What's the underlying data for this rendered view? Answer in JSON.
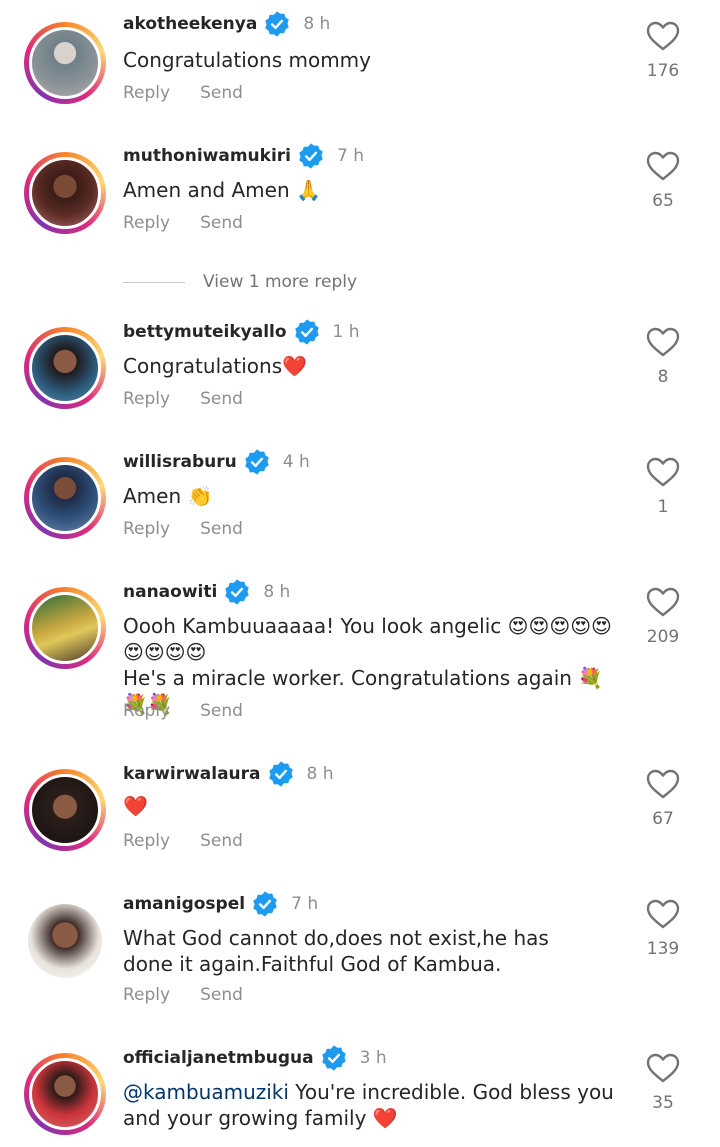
{
  "labels": {
    "reply": "Reply",
    "send": "Send",
    "view_more": "View 1 more reply"
  },
  "comments": [
    {
      "username": "akotheekenya",
      "time": "8 h",
      "text": "Congratulations mommy",
      "likes": "176",
      "ring": true,
      "avatar_color": "#6f7f88"
    },
    {
      "username": "muthoniwamukiri",
      "time": "7 h",
      "text": "Amen and Amen 🙏",
      "likes": "65",
      "ring": true,
      "avatar_color": "#5a2b24"
    },
    {
      "username": "bettymuteikyallo",
      "time": "1 h",
      "text": "Congratulations❤️",
      "likes": "8",
      "ring": true,
      "avatar_color": "#2c5a7a"
    },
    {
      "username": "willisraburu",
      "time": "4 h",
      "text": "Amen 👏",
      "likes": "1",
      "ring": true,
      "avatar_color": "#2e4f7a"
    },
    {
      "username": "nanaowiti",
      "time": "8 h",
      "text": "Oooh Kambuuaaaaa! You look angelic 😍😍😍😍😍 😍😍😍😍",
      "text2": "He's a miracle worker. Congratulations again 💐💐💐",
      "likes": "209",
      "ring": true,
      "avatar_color": "#c7a640"
    },
    {
      "username": "karwirwalaura",
      "time": "8 h",
      "text": "❤️",
      "likes": "67",
      "ring": true,
      "avatar_color": "#2a1e1a"
    },
    {
      "username": "amanigospel",
      "time": "7 h",
      "text": "What God cannot do,does not exist,he has done it again.Faithful God of Kambua.",
      "likes": "139",
      "ring": false,
      "avatar_color": "#3b2a25"
    },
    {
      "username": "officialjanetmbugua",
      "time": "3 h",
      "mention": "@kambuamuziki",
      "text": " You're incredible. God bless you and your growing family ❤️",
      "likes": "35",
      "ring": true,
      "avatar_color": "#c8343a"
    }
  ],
  "colors": {
    "verified": "#1d9bf0",
    "ring": "#dd2a7b"
  },
  "icons": {
    "verified": "verified-badge-icon",
    "like": "heart-outline-icon"
  }
}
